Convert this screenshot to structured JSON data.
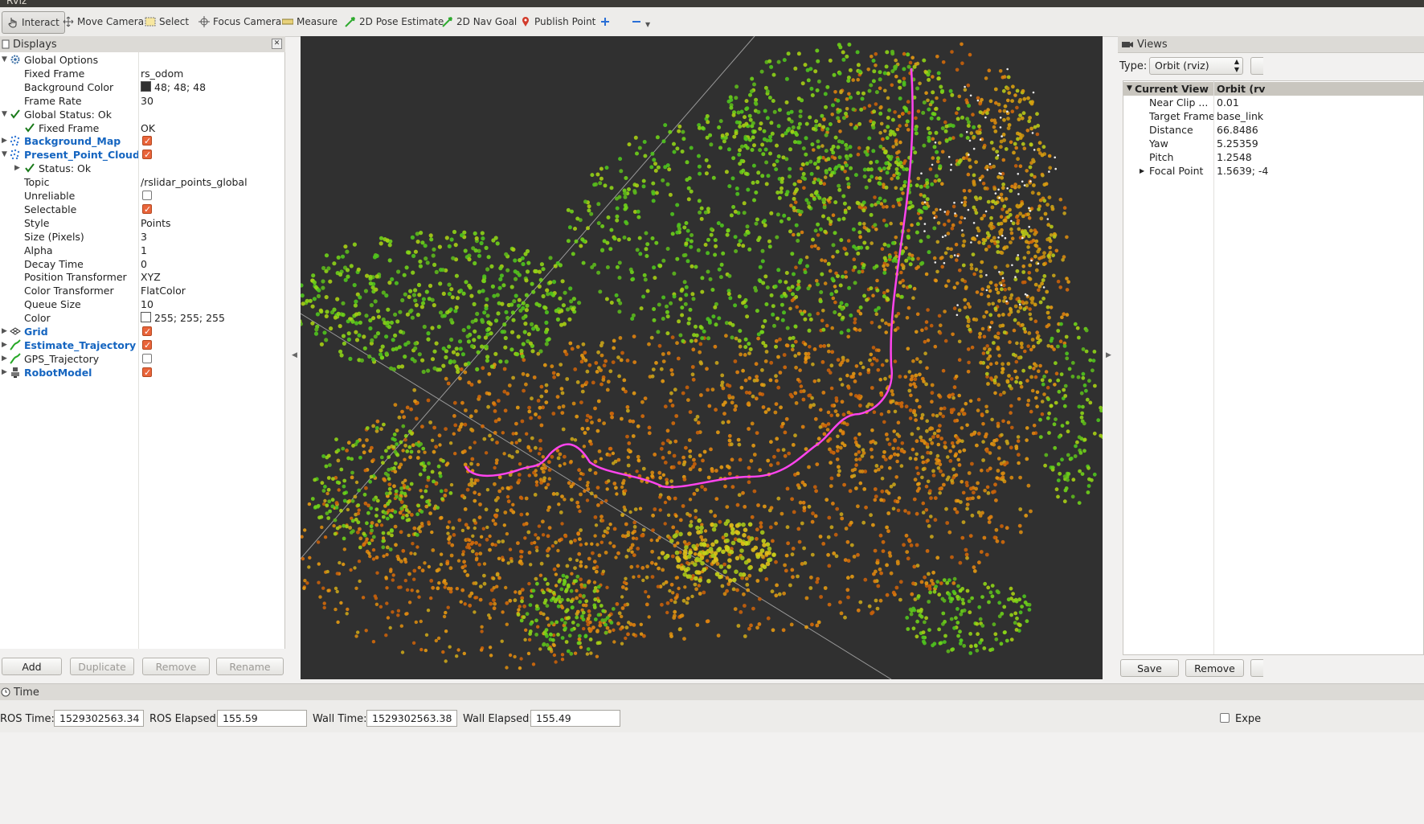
{
  "app": {
    "title": "RViz"
  },
  "toolbar": {
    "tools": [
      {
        "label": "Interact"
      },
      {
        "label": "Move Camera"
      },
      {
        "label": "Select"
      },
      {
        "label": "Focus Camera"
      },
      {
        "label": "Measure"
      },
      {
        "label": "2D Pose Estimate"
      },
      {
        "label": "2D Nav Goal"
      },
      {
        "label": "Publish Point"
      }
    ],
    "add_tool_icon": "plus-icon",
    "remove_tool_icon": "minus-icon"
  },
  "displays": {
    "title": "Displays",
    "rows": [
      {
        "name": "Global Options",
        "value": ""
      },
      {
        "name": "Fixed Frame",
        "value": "rs_odom"
      },
      {
        "name": "Background Color",
        "value": "48; 48; 48"
      },
      {
        "name": "Frame Rate",
        "value": "30"
      },
      {
        "name": "Global Status: Ok",
        "value": ""
      },
      {
        "name": "Fixed Frame",
        "value": "OK"
      },
      {
        "name": "Background_Map",
        "value": ""
      },
      {
        "name": "Present_Point_Cloud",
        "value": ""
      },
      {
        "name": "Status: Ok",
        "value": ""
      },
      {
        "name": "Topic",
        "value": "/rslidar_points_global"
      },
      {
        "name": "Unreliable",
        "value": ""
      },
      {
        "name": "Selectable",
        "value": ""
      },
      {
        "name": "Style",
        "value": "Points"
      },
      {
        "name": "Size (Pixels)",
        "value": "3"
      },
      {
        "name": "Alpha",
        "value": "1"
      },
      {
        "name": "Decay Time",
        "value": "0"
      },
      {
        "name": "Position Transformer",
        "value": "XYZ"
      },
      {
        "name": "Color Transformer",
        "value": "FlatColor"
      },
      {
        "name": "Queue Size",
        "value": "10"
      },
      {
        "name": "Color",
        "value": "255; 255; 255"
      },
      {
        "name": "Grid",
        "value": ""
      },
      {
        "name": "Estimate_Trajectory",
        "value": ""
      },
      {
        "name": "GPS_Trajectory",
        "value": ""
      },
      {
        "name": "RobotModel",
        "value": ""
      }
    ],
    "checkboxes": {
      "background_map": true,
      "present_point_cloud": true,
      "unreliable": false,
      "selectable": true,
      "grid": true,
      "estimate_trajectory": true,
      "gps_trajectory": false,
      "robotmodel": true
    },
    "background_color_hex": "#303030",
    "color_hex": "#ffffff",
    "buttons": {
      "add": "Add",
      "duplicate": "Duplicate",
      "remove": "Remove",
      "rename": "Rename"
    }
  },
  "views": {
    "title": "Views",
    "type_label": "Type:",
    "type_value": "Orbit (rviz)",
    "header_name": "Current View",
    "header_value": "Orbit (rv",
    "rows": [
      {
        "name": "Near Clip ...",
        "value": "0.01"
      },
      {
        "name": "Target Frame",
        "value": "base_link"
      },
      {
        "name": "Distance",
        "value": "66.8486"
      },
      {
        "name": "Yaw",
        "value": "5.25359"
      },
      {
        "name": "Pitch",
        "value": "1.2548"
      },
      {
        "name": "Focal Point",
        "value": "1.5639; -4"
      }
    ],
    "buttons": {
      "save": "Save",
      "remove": "Remove"
    }
  },
  "time": {
    "title": "Time",
    "ros_time_label": "ROS Time:",
    "ros_time": "1529302563.34",
    "ros_elapsed_label": "ROS Elapsed:",
    "ros_elapsed": "155.59",
    "wall_time_label": "Wall Time:",
    "wall_time": "1529302563.38",
    "wall_elapsed_label": "Wall Elapsed:",
    "wall_elapsed": "155.49",
    "experimental_label": "Expe"
  },
  "viewport": {
    "background": "#303030",
    "cloud_colors": [
      "#e08a10",
      "#d4700a",
      "#b0d010",
      "#7bd418",
      "#4ec820",
      "#c4a020"
    ],
    "trajectory_color": "#ff44ee",
    "grid_line_color": "#9a9a9a"
  }
}
